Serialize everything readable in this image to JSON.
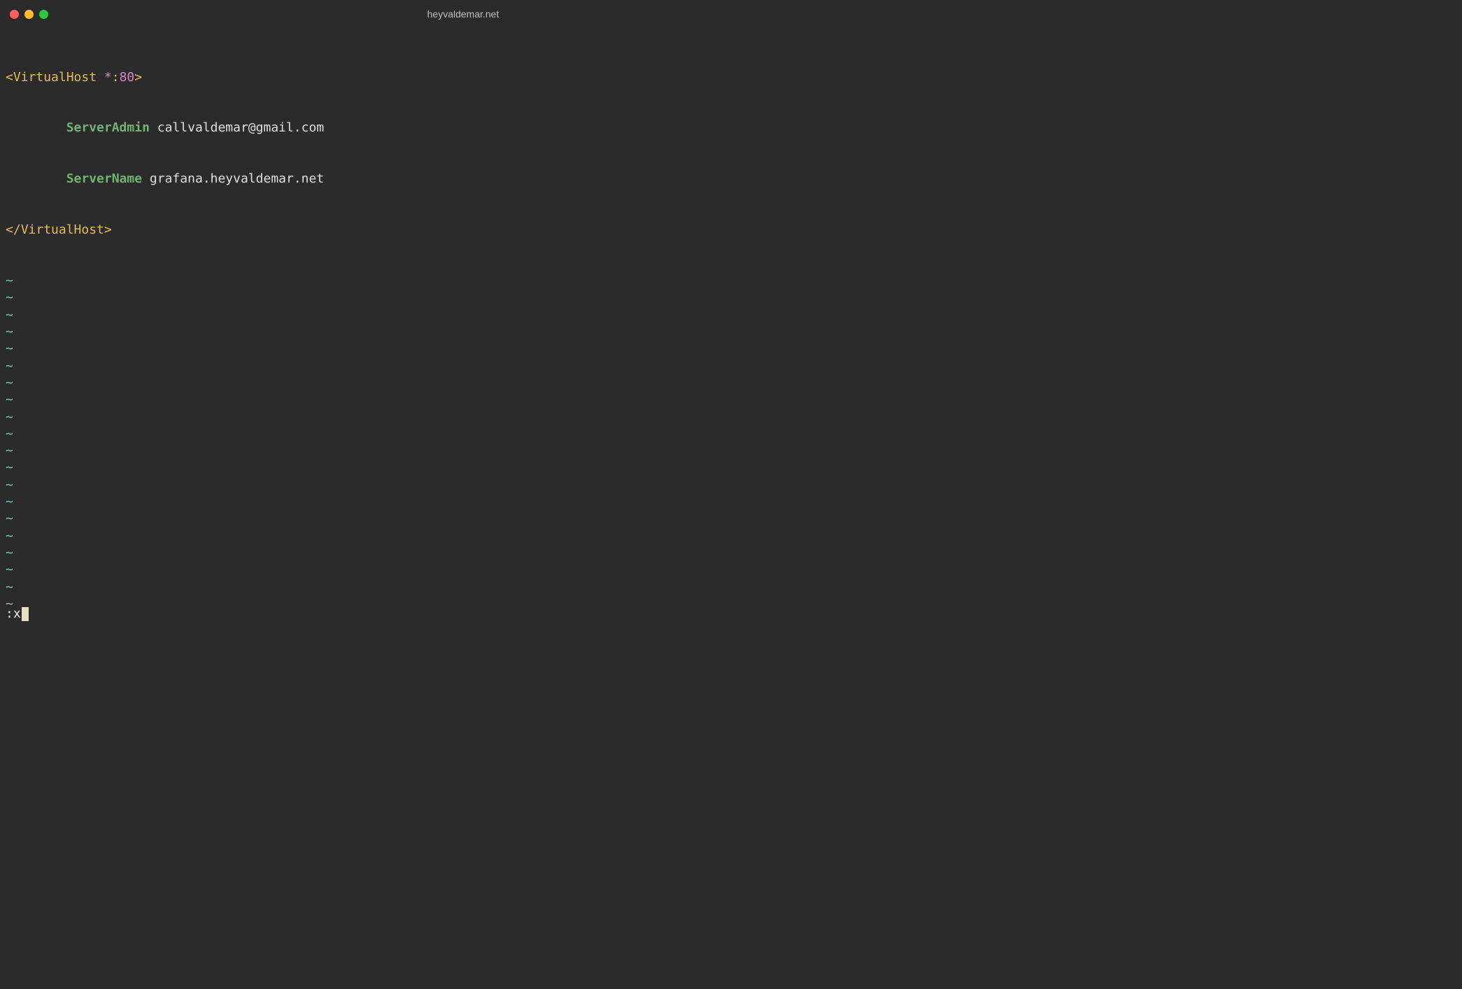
{
  "window": {
    "title": "heyvaldemar.net"
  },
  "code": {
    "open_bracket": "<",
    "open_tag": "VirtualHost",
    "space": " ",
    "star": "*",
    "colon": ":",
    "port": "80",
    "close_bracket": ">",
    "indent": "        ",
    "directive1_key": "ServerAdmin",
    "directive1_val": "callvaldemar@gmail.com",
    "directive2_key": "ServerName",
    "directive2_val": "grafana.heyvaldemar.net",
    "close_open": "</",
    "close_tag": "VirtualHost",
    "close_close": ">"
  },
  "vim": {
    "tilde": "~",
    "command_prefix": ":",
    "command": "x"
  }
}
